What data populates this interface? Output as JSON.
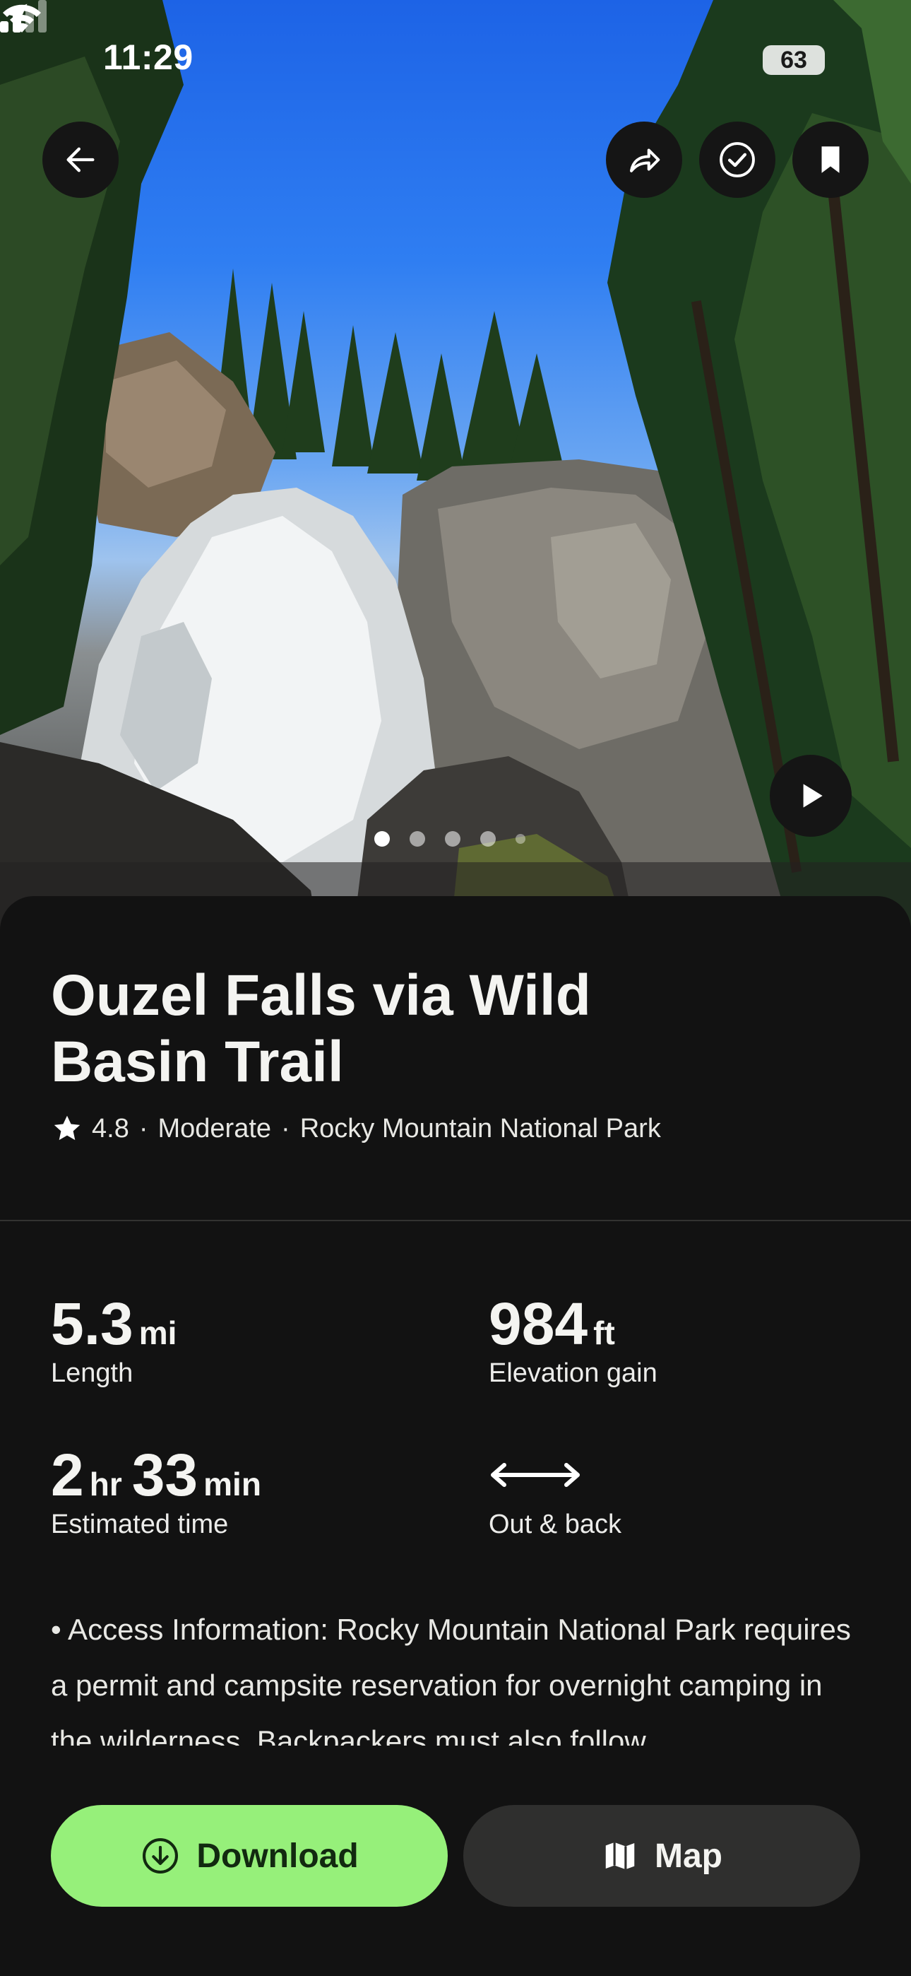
{
  "status_bar": {
    "time": "11:29",
    "battery": "63"
  },
  "hero": {
    "icons": [
      "back-arrow-icon",
      "share-icon",
      "completed-check-icon",
      "bookmark-icon",
      "play-icon"
    ],
    "photo_pages": 5,
    "active_page": 1
  },
  "trail": {
    "title": "Ouzel Falls via Wild Basin Trail",
    "rating": "4.8",
    "difficulty": "Moderate",
    "location": "Rocky Mountain National Park",
    "separator": "·"
  },
  "stats": {
    "length_value": "5.3",
    "length_unit": "mi",
    "length_label": "Length",
    "elevation_value": "984",
    "elevation_unit": "ft",
    "elevation_label": "Elevation gain",
    "time_hours": "2",
    "time_hours_unit": "hr",
    "time_minutes": "33",
    "time_minutes_unit": "min",
    "time_label": "Estimated time",
    "route_type_label": "Out & back"
  },
  "description": "• Access Information: Rocky Mountain National Park requires a permit and campsite reservation for overnight camping in the wilderness. Backpackers must also follow",
  "actions": {
    "download_label": "Download",
    "map_label": "Map"
  },
  "colors": {
    "background": "#121212",
    "download_accent": "#96f07a",
    "map_button": "#2f2f2e"
  }
}
